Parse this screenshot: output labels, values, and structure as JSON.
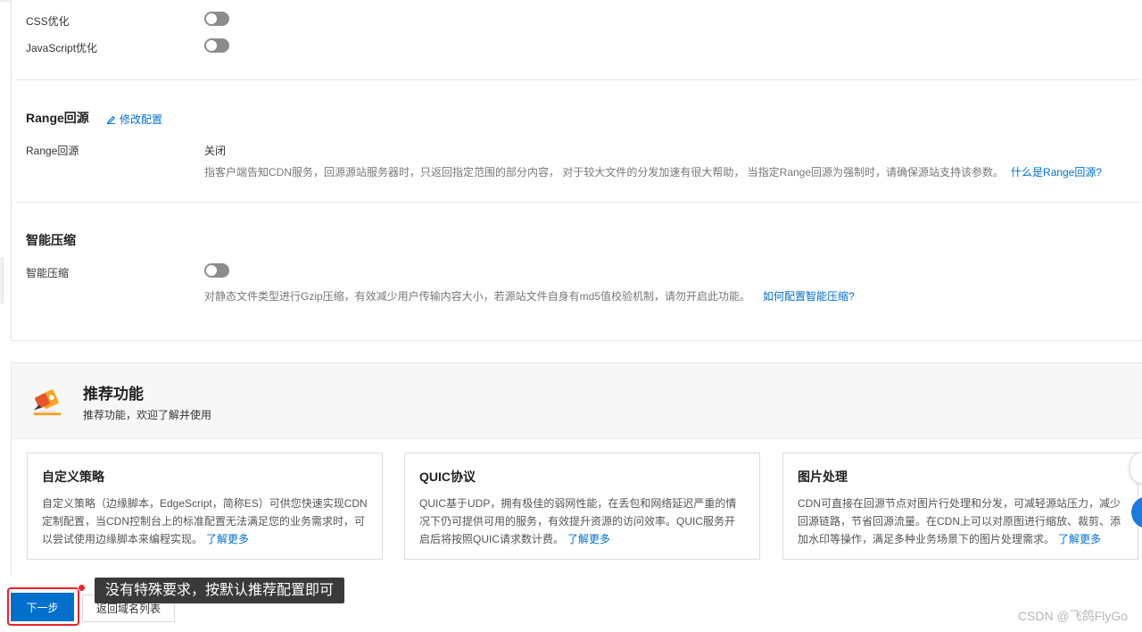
{
  "optimization": {
    "css_label": "CSS优化",
    "js_label": "JavaScript优化",
    "css_enabled": false,
    "js_enabled": false
  },
  "range": {
    "section_title": "Range回源",
    "edit_label": "修改配置",
    "row_label": "Range回源",
    "value": "关闭",
    "description": "指客户端告知CDN服务，回源源站服务器时，只返回指定范围的部分内容， 对于较大文件的分发加速有很大帮助， 当指定Range回源为强制时，请确保源站支持该参数。",
    "help_link": "什么是Range回源?"
  },
  "smart_compress": {
    "section_title": "智能压缩",
    "row_label": "智能压缩",
    "enabled": false,
    "description": "对静态文件类型进行Gzip压缩，有效减少用户传输内容大小，若源站文件自身有md5值校验机制，请勿开启此功能。",
    "help_link": "如何配置智能压缩?"
  },
  "recommend": {
    "title": "推荐功能",
    "subtitle": "推荐功能，欢迎了解并使用",
    "cards": [
      {
        "title": "自定义策略",
        "description": "自定义策略（边缘脚本，EdgeScript，简称ES）可供您快速实现CDN定制配置，当CDN控制台上的标准配置无法满足您的业务需求时，可以尝试使用边缘脚本来编程实现。",
        "more": "了解更多"
      },
      {
        "title": "QUIC协议",
        "description": "QUIC基于UDP，拥有极佳的弱网性能，在丢包和网络延迟严重的情况下仍可提供可用的服务，有效提升资源的访问效率。QUIC服务开启后将按照QUIC请求数计费。",
        "more": "了解更多"
      },
      {
        "title": "图片处理",
        "description": "CDN可直接在回源节点对图片行处理和分发，可减轻源站压力，减少回源链路，节省回源流量。在CDN上可以对原图进行缩放、裁剪、添加水印等操作，满足多种业务场景下的图片处理需求。",
        "more": "了解更多"
      }
    ]
  },
  "footer": {
    "next_label": "下一步",
    "back_label": "返回域名列表",
    "tooltip": "没有特殊要求，按默认推荐配置即可"
  },
  "watermark": "CSDN @飞鸽FlyGo",
  "colors": {
    "link": "#0070cc",
    "primary_button": "#0070cc",
    "highlight": "#e8232c",
    "toggle_off": "#8c8c8c"
  }
}
